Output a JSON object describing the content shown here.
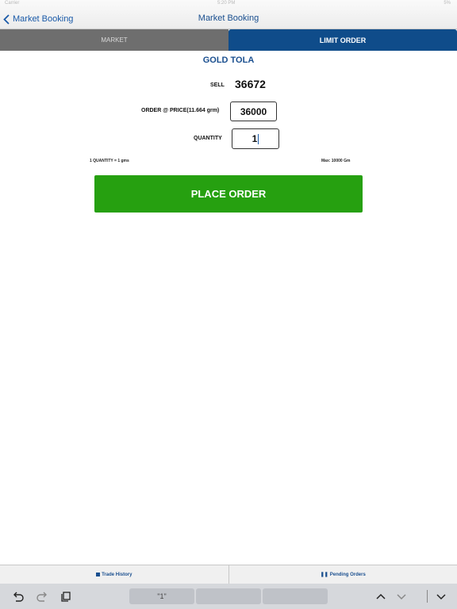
{
  "status": {
    "carrier": "Carrier",
    "time": "5:20 PM",
    "battery": "5%"
  },
  "nav": {
    "back_label": "Market Booking",
    "title": "Market Booking"
  },
  "tabs": [
    {
      "label": "MARKET",
      "active": false
    },
    {
      "label": "LIMIT ORDER",
      "active": true
    }
  ],
  "product": {
    "name": "GOLD TOLA"
  },
  "sell": {
    "label": "SELL",
    "value": "36672"
  },
  "order_price": {
    "label": "ORDER @ PRICE(11.664 grm)",
    "value": "36000"
  },
  "quantity": {
    "label": "QUANTITY",
    "value": "1"
  },
  "info": {
    "conversion": "1 QUANTITY = 1 gms",
    "max": "Max: 10000 Gm"
  },
  "place_order": {
    "label": "PLACE ORDER"
  },
  "bottom_bar": {
    "trade_history": "Trade History",
    "pending_orders": "Pending Orders"
  },
  "keyboard": {
    "suggestion": "\"1\""
  },
  "colors": {
    "brand_blue": "#0f4c8a",
    "action_green": "#26a010",
    "tab_inactive": "#6e6e6e"
  }
}
